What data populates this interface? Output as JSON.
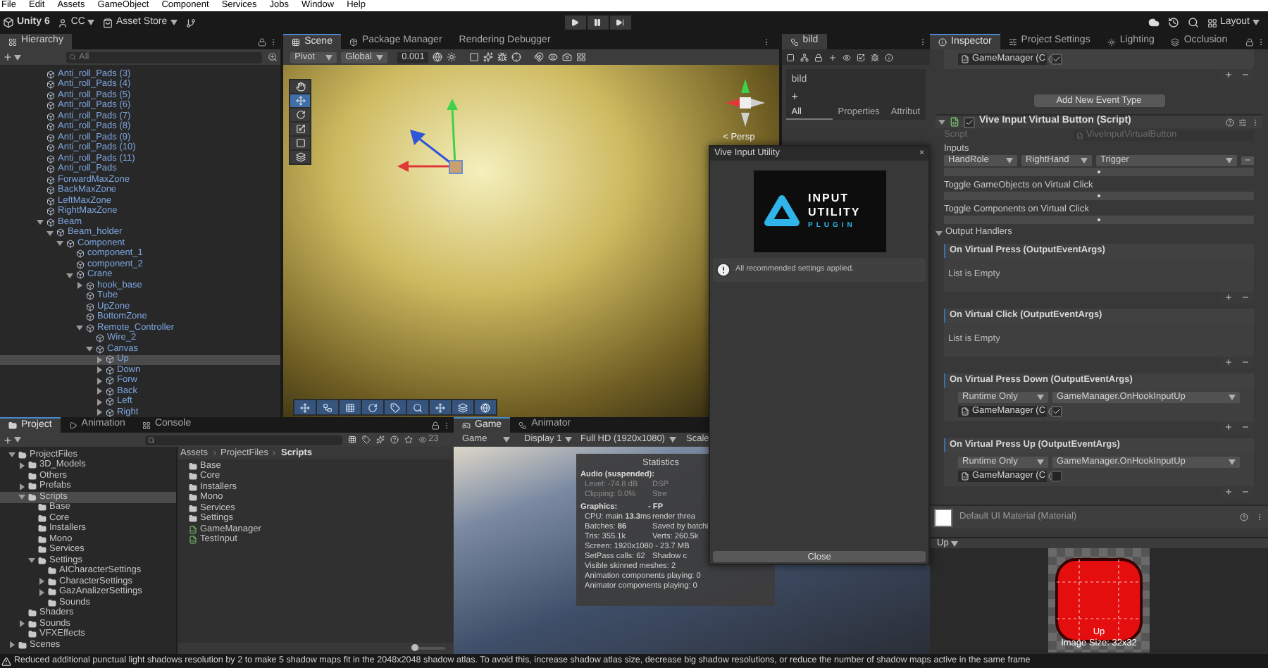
{
  "menu_bar": [
    "File",
    "Edit",
    "Assets",
    "GameObject",
    "Component",
    "Services",
    "Jobs",
    "Window",
    "Help"
  ],
  "toolbar": {
    "app": "Unity 6",
    "account": "CC",
    "asset_store": "Asset Store",
    "layout": "Layout"
  },
  "hierarchy": {
    "title": "Hierarchy",
    "search": {
      "placeholder": "All"
    },
    "items": [
      {
        "name": "Anti_roll_Pads (3)",
        "selected": false
      },
      {
        "name": "Anti_roll_Pads (4)",
        "selected": false
      },
      {
        "name": "Anti_roll_Pads (5)",
        "selected": false
      },
      {
        "name": "Anti_roll_Pads (6)",
        "selected": false
      },
      {
        "name": "Anti_roll_Pads (7)",
        "selected": false
      },
      {
        "name": "Anti_roll_Pads (8)",
        "selected": false
      },
      {
        "name": "Anti_roll_Pads (9)",
        "selected": false
      },
      {
        "name": "Anti_roll_Pads (10)",
        "selected": false
      },
      {
        "name": "Anti_roll_Pads (11)",
        "selected": false
      },
      {
        "name": "Anti_roll_Pads",
        "selected": false
      },
      {
        "name": "ForwardMaxZone",
        "selected": false
      },
      {
        "name": "BackMaxZone",
        "selected": false
      },
      {
        "name": "LeftMaxZone",
        "selected": false
      },
      {
        "name": "RightMaxZone",
        "selected": false
      },
      {
        "name": "Beam",
        "selected": false,
        "expanded": true,
        "children": [
          {
            "name": "Beam_holder",
            "selected": false,
            "expanded": true,
            "children": [
              {
                "name": "Component",
                "selected": false,
                "expanded": true,
                "children": [
                  {
                    "name": "component_1",
                    "selected": false
                  },
                  {
                    "name": "component_2",
                    "selected": false
                  },
                  {
                    "name": "Crane",
                    "selected": false,
                    "expanded": true,
                    "children": [
                      {
                        "name": "hook_base",
                        "selected": false,
                        "expanded": false
                      },
                      {
                        "name": "Tube",
                        "selected": false
                      },
                      {
                        "name": "UpZone",
                        "selected": false
                      },
                      {
                        "name": "BottomZone",
                        "selected": false
                      },
                      {
                        "name": "Remote_Controller",
                        "selected": false,
                        "expanded": true,
                        "children": [
                          {
                            "name": "Wire_2",
                            "selected": false
                          },
                          {
                            "name": "Canvas",
                            "selected": false,
                            "expanded": true,
                            "children": [
                              {
                                "name": "Up",
                                "selected": true,
                                "expanded": false
                              },
                              {
                                "name": "Down",
                                "selected": false,
                                "expanded": false
                              },
                              {
                                "name": "Forw",
                                "selected": false,
                                "expanded": false
                              },
                              {
                                "name": "Back",
                                "selected": false,
                                "expanded": false
                              },
                              {
                                "name": "Left",
                                "selected": false,
                                "expanded": false
                              },
                              {
                                "name": "Right",
                                "selected": false,
                                "expanded": false
                              }
                            ]
                          }
                        ]
                      }
                    ]
                  }
                ]
              }
            ]
          }
        ]
      }
    ]
  },
  "scene": {
    "tabs": [
      {
        "label": "Scene",
        "selected": true
      },
      {
        "label": "Package Manager",
        "selected": false
      },
      {
        "label": "Rendering Debugger",
        "selected": false
      }
    ],
    "pivot": "Pivot",
    "space": "Global",
    "snap": "0.001",
    "view_label": "< Persp",
    "tools": [
      {
        "kind": "hand",
        "selected": false
      },
      {
        "kind": "move",
        "selected": true
      },
      {
        "kind": "rotate",
        "selected": false
      },
      {
        "kind": "scale",
        "selected": false
      },
      {
        "kind": "rect",
        "selected": false
      },
      {
        "kind": "transform",
        "selected": false
      }
    ]
  },
  "bild_panel": {
    "tab": "bild",
    "title": "bild",
    "add": "+",
    "tabs": [
      {
        "label": "All",
        "selected": true
      },
      {
        "label": "Properties",
        "selected": false
      },
      {
        "label": "Attribut",
        "selected": false
      }
    ]
  },
  "vive_window": {
    "title": "Vive Input Utility",
    "close": "×",
    "logo": [
      "INPUT",
      "UTILITY",
      "PLUGIN"
    ],
    "message": "All recommended settings applied.",
    "button": "Close"
  },
  "project": {
    "tabs": [
      {
        "label": "Project",
        "selected": true
      },
      {
        "label": "Animation",
        "selected": false
      },
      {
        "label": "Console",
        "selected": false
      }
    ],
    "hidden_count": "23",
    "tree": [
      {
        "name": "ProjectFiles",
        "selected": false,
        "expanded": true,
        "children": [
          {
            "name": "3D_Models",
            "selected": false,
            "expanded": false
          },
          {
            "name": "Others",
            "selected": false
          },
          {
            "name": "Prefabs",
            "selected": false,
            "expanded": false
          },
          {
            "name": "Scripts",
            "selected": true,
            "expanded": true,
            "children": [
              {
                "name": "Base",
                "selected": false
              },
              {
                "name": "Core",
                "selected": false
              },
              {
                "name": "Installers",
                "selected": false
              },
              {
                "name": "Mono",
                "selected": false
              },
              {
                "name": "Services",
                "selected": false
              },
              {
                "name": "Settings",
                "selected": false,
                "expanded": true,
                "children": [
                  {
                    "name": "AICharacterSettings",
                    "selected": false
                  },
                  {
                    "name": "CharacterSettings",
                    "selected": false,
                    "expanded": false
                  },
                  {
                    "name": "GazAnalizerSettings",
                    "selected": false,
                    "expanded": false
                  },
                  {
                    "name": "Sounds",
                    "selected": false
                  }
                ]
              }
            ]
          },
          {
            "name": "Shaders",
            "selected": false
          },
          {
            "name": "Sounds",
            "selected": false,
            "expanded": false
          },
          {
            "name": "VFXEffects",
            "selected": false
          }
        ]
      },
      {
        "name": "Scenes",
        "selected": false,
        "expanded": false
      }
    ],
    "breadcrumb": [
      "Assets",
      "ProjectFiles",
      "Scripts"
    ],
    "files": [
      {
        "name": "Base",
        "kind": "folder"
      },
      {
        "name": "Core",
        "kind": "folder"
      },
      {
        "name": "Installers",
        "kind": "folder"
      },
      {
        "name": "Mono",
        "kind": "folder"
      },
      {
        "name": "Services",
        "kind": "folder"
      },
      {
        "name": "Settings",
        "kind": "folder"
      },
      {
        "name": "GameManager",
        "kind": "script"
      },
      {
        "name": "TestInput",
        "kind": "script"
      }
    ],
    "zoom": {
      "level": 0.1
    }
  },
  "game": {
    "tabs": [
      {
        "label": "Game",
        "selected": true
      },
      {
        "label": "Animator",
        "selected": false
      }
    ],
    "view_mode": "Game",
    "display": "Display 1",
    "resolution": "Full HD (1920x1080)",
    "scale": "Scale",
    "stats": {
      "title": "Statistics",
      "lines": [
        {
          "kind": "heading",
          "text": "Audio (suspended):"
        },
        {
          "kind": "muted",
          "text": "Level: -74.8 dB",
          "right": "DSP"
        },
        {
          "kind": "muted",
          "text": "Clipping: 0.0%",
          "right": "Stre"
        },
        {
          "kind": "heading",
          "text": "Graphics:",
          "right": "- FP"
        },
        {
          "kind": "plain",
          "text": "CPU: main **13.3**ms",
          "right": "render threa"
        },
        {
          "kind": "plain",
          "text": "Batches: **86**",
          "right": "Saved by batchi"
        },
        {
          "kind": "plain",
          "text": "Tris: 355.1k",
          "right": "Verts: 260.5k"
        },
        {
          "kind": "plain",
          "text": "Screen: 1920x1080 - 23.7 MB"
        },
        {
          "kind": "plain",
          "text": "SetPass calls: 62",
          "right": "Shadow c"
        },
        {
          "kind": "plain",
          "text": "Visible skinned meshes: 2"
        },
        {
          "kind": "plain",
          "text": "Animation components playing: 0"
        },
        {
          "kind": "plain",
          "text": "Animator components playing: 0"
        }
      ]
    }
  },
  "inspector": {
    "tabs": [
      {
        "label": "Inspector",
        "selected": true
      },
      {
        "label": "Project Settings",
        "selected": false
      },
      {
        "label": "Lighting",
        "selected": false
      },
      {
        "label": "Occlusion",
        "selected": false
      }
    ],
    "top_event": {
      "target": "GameManager (C",
      "checked": true
    },
    "add_event_button": "Add New Event Type",
    "component": {
      "title": "Vive Input Virtual Button (Script)",
      "enabled": true,
      "expanded": true,
      "script_label": "Script",
      "script": "ViveInputVirtualButton",
      "inputs_label": "Inputs",
      "inputs": [
        "HandRole",
        "RightHand",
        "Trigger"
      ],
      "toggle_gameobjects": "Toggle GameObjects on Virtual Click",
      "toggle_components": "Toggle Components on Virtual Click",
      "output_handlers": {
        "label": "Output Handlers",
        "expanded": true
      },
      "events": [
        {
          "title": "On Virtual Press (OutputEventArgs)",
          "kind": "empty",
          "text": "List is Empty"
        },
        {
          "title": "On Virtual Click (OutputEventArgs)",
          "kind": "empty",
          "text": "List is Empty"
        },
        {
          "title": "On Virtual Press Down (OutputEventArgs)",
          "kind": "listener",
          "mode": "Runtime Only",
          "function": "GameManager.OnHookInputUp",
          "target": "GameManager (C",
          "checked": true
        },
        {
          "title": "On Virtual Press Up (OutputEventArgs)",
          "kind": "listener",
          "mode": "Runtime Only",
          "function": "GameManager.OnHookInputUp",
          "target": "GameManager (C",
          "checked": false
        }
      ]
    },
    "material": {
      "name": "Default UI Material (Material)"
    },
    "preview": {
      "dropdown": "Up",
      "label": "Up",
      "size": "Image Size: 32x32"
    }
  },
  "status": "Reduced additional punctual light shadows resolution by 2 to make 5 shadow maps fit in the 2048x2048 shadow atlas. To avoid this, increase shadow atlas size, decrease big shadow resolutions, or reduce the number of shadow maps active in the same frame"
}
